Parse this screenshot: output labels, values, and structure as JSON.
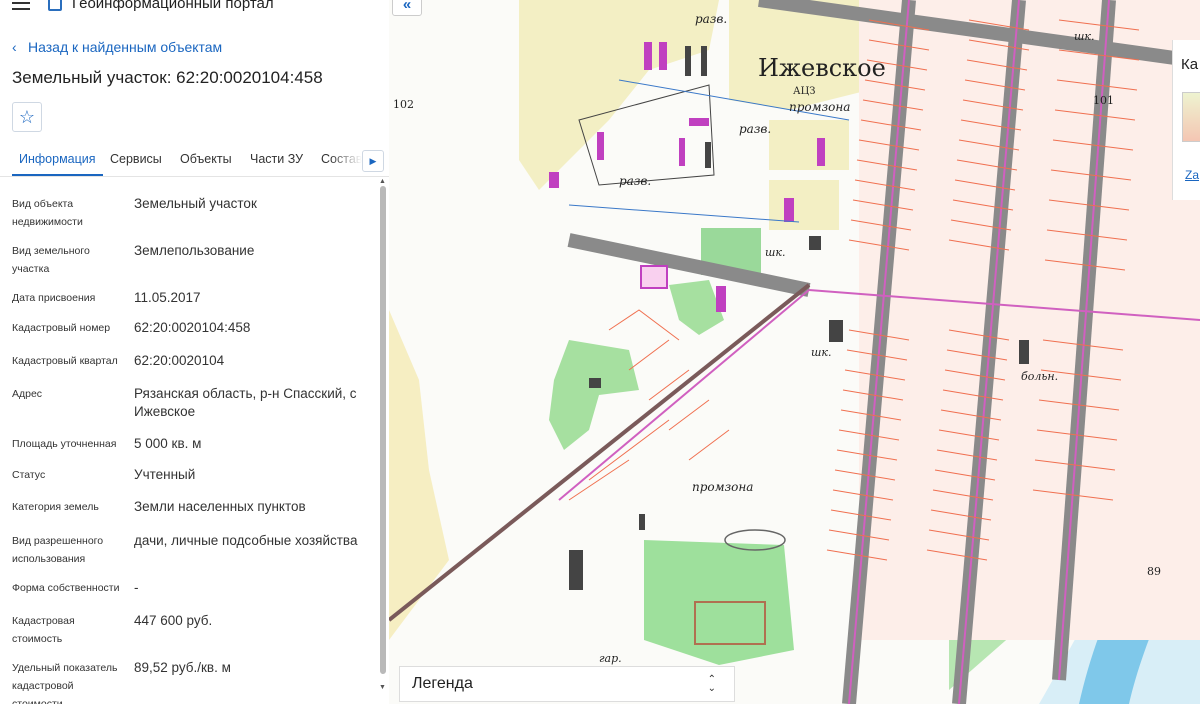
{
  "app": {
    "title": "Геоинформационный портал"
  },
  "nav": {
    "back_label": "Назад к найденным объектам"
  },
  "page": {
    "title": "Земельный участок: 62:20:0020104:458"
  },
  "tabs": [
    {
      "label": "Информация"
    },
    {
      "label": "Сервисы"
    },
    {
      "label": "Объекты"
    },
    {
      "label": "Части ЗУ"
    },
    {
      "label": "Состав"
    }
  ],
  "info": [
    {
      "label": "Вид объекта недвижимости",
      "value": "Земельный участок"
    },
    {
      "label": "Вид земельного участка",
      "value": "Землепользование"
    },
    {
      "label": "Дата присвоения",
      "value": "11.05.2017"
    },
    {
      "label": "Кадастровый номер",
      "value": "62:20:0020104:458"
    },
    {
      "label": "Кадастровый квартал",
      "value": "62:20:0020104"
    },
    {
      "label": "Адрес",
      "value": "Рязанская область, р-н Спасский, с Ижевское"
    },
    {
      "label": "Площадь уточненная",
      "value": "5 000 кв. м"
    },
    {
      "label": "Статус",
      "value": "Учтенный"
    },
    {
      "label": "Категория земель",
      "value": "Земли населенных пунктов"
    },
    {
      "label": "Вид разрешенного использования",
      "value": "дачи, личные подсобные хозяйства"
    },
    {
      "label": "Форма собственности",
      "value": "-"
    },
    {
      "label": "Кадастровая стоимость",
      "value": "447 600 руб."
    },
    {
      "label": "Удельный показатель кадастровой стоимости",
      "value": "89,52 руб./кв. м"
    }
  ],
  "map": {
    "labels": {
      "village": "Ижевское",
      "razv1": "разв.",
      "razv2": "разв.",
      "razv3": "разв.",
      "promzona1": "промзона",
      "promzona2": "промзона",
      "azs": "АЦЗ",
      "shk1": "шк.",
      "shk2": "шк.",
      "shk3": "шк.",
      "boln": "больн.",
      "gar": "гар.",
      "h102": "102",
      "h101": "101",
      "h89": "89"
    },
    "legend_label": "Легенда",
    "right_panel": {
      "text": "Ка",
      "link": "Za"
    }
  }
}
